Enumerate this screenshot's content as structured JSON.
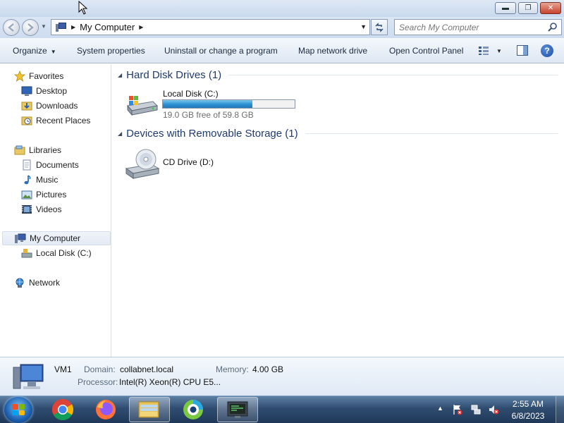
{
  "window": {
    "minimize_glyph": "▬",
    "maximize_glyph": "❐",
    "close_glyph": "✕"
  },
  "address": {
    "location": "My Computer",
    "search_placeholder": "Search My Computer"
  },
  "toolbar": {
    "organize": "Organize",
    "system_properties": "System properties",
    "uninstall": "Uninstall or change a program",
    "map_network_drive": "Map network drive",
    "open_control_panel": "Open Control Panel",
    "help": "?"
  },
  "sidebar": {
    "favorites": "Favorites",
    "desktop": "Desktop",
    "downloads": "Downloads",
    "recent_places": "Recent Places",
    "libraries": "Libraries",
    "documents": "Documents",
    "music": "Music",
    "pictures": "Pictures",
    "videos": "Videos",
    "my_computer": "My Computer",
    "local_disk": "Local Disk (C:)",
    "network": "Network"
  },
  "main": {
    "hdd_group": "Hard Disk Drives (1)",
    "removable_group": "Devices with Removable Storage (1)",
    "drive_c": {
      "name": "Local Disk (C:)",
      "free_text": "19.0 GB free of 59.8 GB",
      "used_fraction": 0.68
    },
    "drive_d": {
      "name": "CD Drive (D:)"
    }
  },
  "details": {
    "computer_name": "VM1",
    "domain_label": "Domain:",
    "domain_value": "collabnet.local",
    "memory_label": "Memory:",
    "memory_value": "4.00 GB",
    "processor_label": "Processor:",
    "processor_value": "Intel(R) Xeon(R) CPU E5..."
  },
  "taskbar": {
    "time": "2:55 AM",
    "date": "6/8/2023"
  },
  "colors": {
    "accent": "#1e3a6e",
    "progress_fill": "#2a8fd1",
    "taskbar": "#2f4c70"
  }
}
